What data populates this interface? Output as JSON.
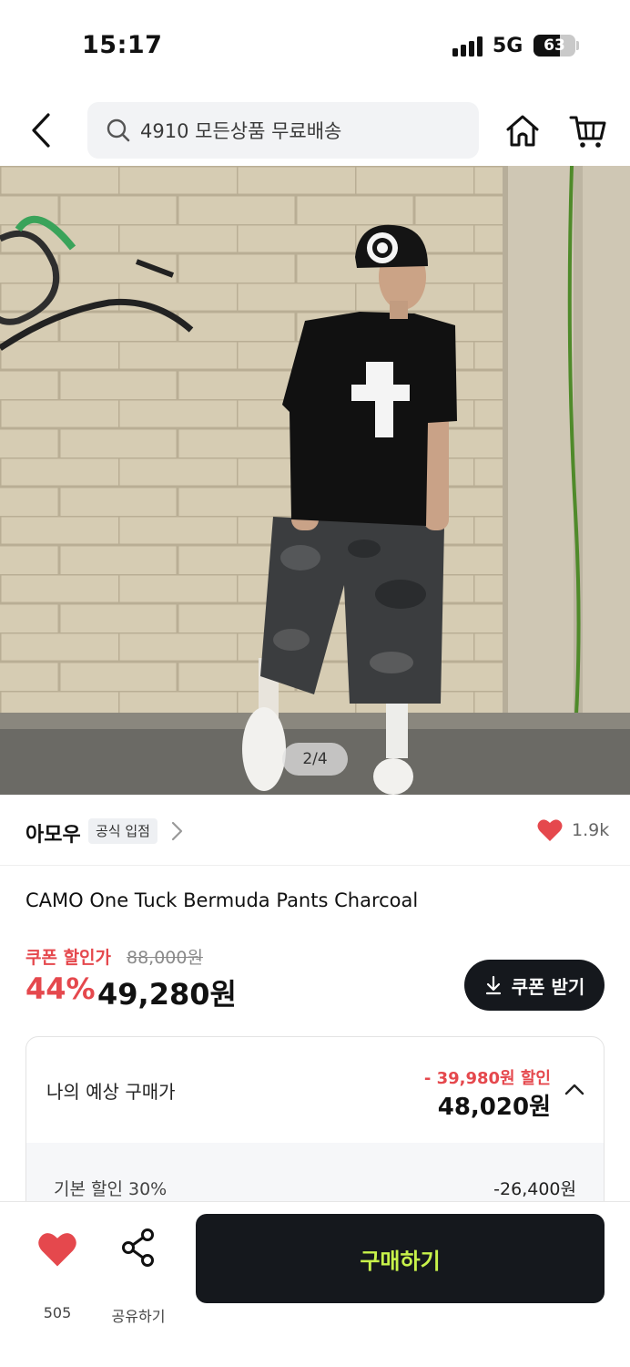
{
  "status_bar": {
    "time": "15:17",
    "network": "5G",
    "battery": "63",
    "battery_level": 0.63
  },
  "header": {
    "search_text": "4910 모든상품 무료배송"
  },
  "gallery": {
    "counter": "2/4"
  },
  "store": {
    "name": "아모우",
    "badge": "공식 입점",
    "like_count": "1.9k"
  },
  "product": {
    "title": "CAMO One Tuck Bermuda Pants Charcoal",
    "coupon_label": "쿠폰 할인가",
    "original_price": "88,000원",
    "discount_rate": "44%",
    "final_price": "49,280원",
    "coupon_button": "쿠폰 받기"
  },
  "expected": {
    "label": "나의 예상 구매가",
    "discount": "- 39,980원 할인",
    "price": "48,020원",
    "detail_label": "기본 할인 30%",
    "detail_value": "-26,400원"
  },
  "bottom_bar": {
    "like_count": "505",
    "share_label": "공유하기",
    "buy_label": "구매하기"
  },
  "colors": {
    "accent_red": "#e5484d",
    "buy_text": "#c8f24a",
    "dark": "#15181d"
  }
}
